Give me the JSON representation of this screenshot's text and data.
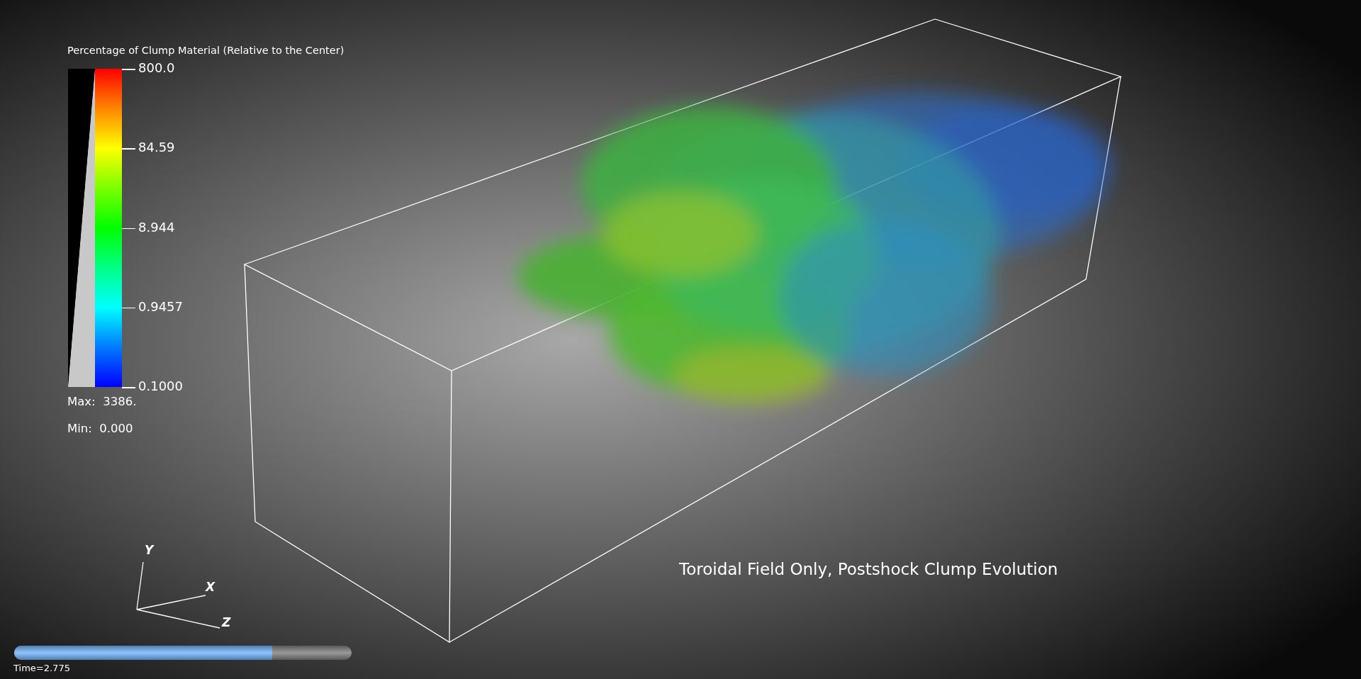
{
  "legend": {
    "title": "Percentage of Clump Material (Relative to the Center)",
    "ticks": [
      "800.0",
      "84.59",
      "8.944",
      "0.9457",
      "0.1000"
    ],
    "max_label": "Max:  3386.",
    "min_label": "Min:  0.000"
  },
  "caption": "Toroidal Field Only, Postshock Clump Evolution",
  "axes": {
    "labels": [
      "Y",
      "X",
      "Z"
    ]
  },
  "time_slider": {
    "level": 0.765,
    "label": "Time=2.775"
  }
}
